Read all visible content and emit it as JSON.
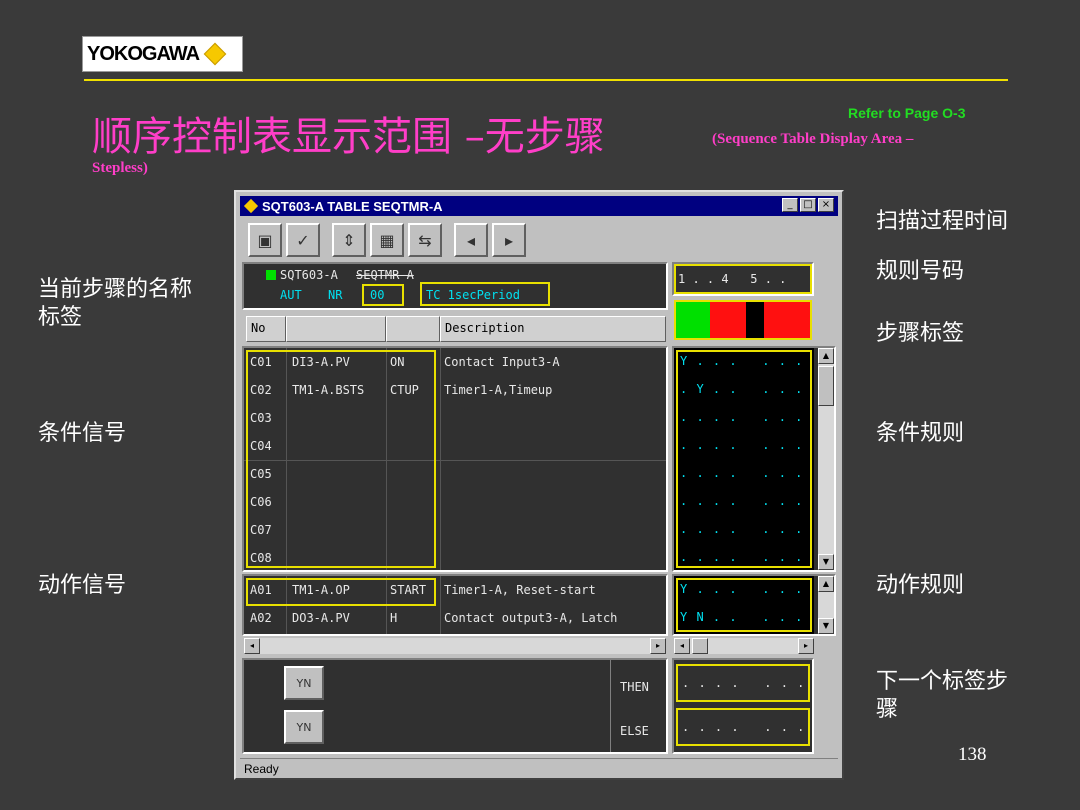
{
  "slide": {
    "logo_text": "YOKOGAWA",
    "title_zh": "顺序控制表显示范围 –无步骤",
    "title_en_1": "(Sequence Table Display Area –",
    "title_en_2": "Stepless)",
    "refer": "Refer to Page O-3",
    "page_number": "138"
  },
  "labels": {
    "current_step_name": "当前步骤的名称",
    "tag": "标签",
    "condition_signal": "条件信号",
    "action_signal": "动作信号",
    "scan_period": "扫描过程时间",
    "rule_number": "规则号码",
    "step_label": "步骤标签",
    "condition_rule": "条件规则",
    "action_rule": "动作规则",
    "next_step_label_1": "下一个标签步",
    "next_step_label_2": "骤"
  },
  "window": {
    "title": "SQT603-A TABLE SEQTMR-A",
    "buttons": [
      "_",
      "□",
      "×"
    ],
    "status": "Ready",
    "tag_name": "SQT603-A",
    "tag_comment": "SEQTMR-A",
    "mode": "AUT",
    "alarm": "NR",
    "step": "00",
    "period": "TC 1secPeriod",
    "rule_numbers": "1 . . 4   5 . .",
    "header": {
      "no": "No",
      "description": "Description"
    },
    "conditions": [
      {
        "no": "C01",
        "tag": "DI3-A.PV",
        "data": "ON",
        "desc": "Contact Input3-A",
        "rule": "Y . . .   . . ."
      },
      {
        "no": "C02",
        "tag": "TM1-A.BSTS",
        "data": "CTUP",
        "desc": "Timer1-A,Timeup",
        "rule": ". Y . .   . . ."
      },
      {
        "no": "C03",
        "tag": "",
        "data": "",
        "desc": "",
        "rule": ". . . .   . . ."
      },
      {
        "no": "C04",
        "tag": "",
        "data": "",
        "desc": "",
        "rule": ". . . .   . . ."
      },
      {
        "no": "C05",
        "tag": "",
        "data": "",
        "desc": "",
        "rule": ". . . .   . . ."
      },
      {
        "no": "C06",
        "tag": "",
        "data": "",
        "desc": "",
        "rule": ". . . .   . . ."
      },
      {
        "no": "C07",
        "tag": "",
        "data": "",
        "desc": "",
        "rule": ". . . .   . . ."
      },
      {
        "no": "C08",
        "tag": "",
        "data": "",
        "desc": "",
        "rule": ". . . .   . . ."
      }
    ],
    "actions": [
      {
        "no": "A01",
        "tag": "TM1-A.OP",
        "data": "START",
        "desc": "Timer1-A, Reset-start",
        "rule": "Y . . .   . . ."
      },
      {
        "no": "A02",
        "tag": "DO3-A.PV",
        "data": "H",
        "desc": "Contact output3-A, Latch",
        "rule": "Y N . .   . . ."
      }
    ],
    "then_label": "THEN",
    "else_label": "ELSE",
    "then_rule": ". . . .   . . .",
    "else_rule": ". . . .   . . .",
    "yn_label": "YN"
  },
  "colors": {
    "title": "#ff3ec8",
    "refer": "#22dd22",
    "highlight": "#e8e000",
    "status_green": "#00e000",
    "status_red": "#ff1010"
  }
}
